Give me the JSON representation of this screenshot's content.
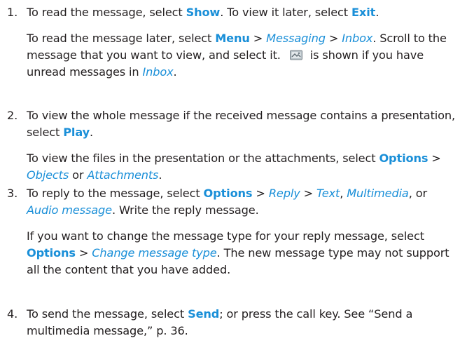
{
  "steps": [
    {
      "number": "1.",
      "paragraphs": [
        {
          "t1": "To read the message, select ",
          "b1": "Show",
          "t2": ". To view it later, select ",
          "b2": "Exit",
          "t3": "."
        },
        {
          "t1": "To read the message later, select ",
          "b1": "Menu",
          "sep1": " > ",
          "i1": "Messaging",
          "sep2": " > ",
          "i2": "Inbox",
          "t2": ". Scroll to the message that you want to view, and select it. ",
          "icon": "unread-message-icon",
          "t3": " is shown if you have unread messages in ",
          "i3": "Inbox",
          "t4": "."
        }
      ]
    },
    {
      "number": "2.",
      "paragraphs": [
        {
          "t1": "To view the whole message if the received message contains a presentation, select ",
          "b1": "Play",
          "t2": "."
        },
        {
          "t1": "To view the files in the presentation or the attachments, select ",
          "b1": "Options",
          "sep1": " > ",
          "i1": "Objects",
          "t2": " or ",
          "i2": "Attachments",
          "t3": "."
        }
      ]
    },
    {
      "number": "3.",
      "paragraphs": [
        {
          "t1": "To reply to the message, select ",
          "b1": "Options",
          "sep1": " > ",
          "i1": "Reply",
          "sep2": " > ",
          "i2": "Text",
          "t2": ", ",
          "i3": "Multimedia",
          "t3": ", or ",
          "i4": "Audio message",
          "t4": ". Write the reply message."
        },
        {
          "t1": "If you want to change the message type for your reply message, select ",
          "b1": "Options",
          "sep1": " > ",
          "i1": "Change message type",
          "t2": ". The new message type may not support all the content that you have added."
        }
      ]
    },
    {
      "number": "4.",
      "paragraphs": [
        {
          "t1": "To send the message, select ",
          "b1": "Send",
          "t2": "; or press the call key. See “Send a multimedia message,” p. 36."
        }
      ]
    }
  ]
}
